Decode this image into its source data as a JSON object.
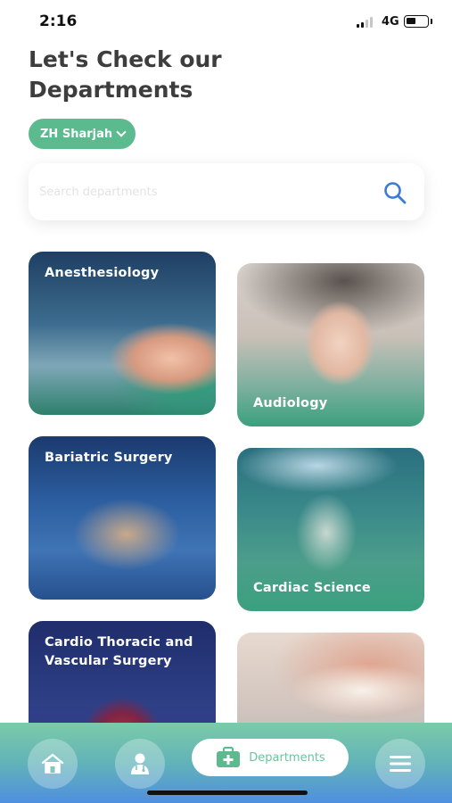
{
  "status_bar": {
    "time": "2:16",
    "network": "4G"
  },
  "header": {
    "title": "Let's Check our Departments"
  },
  "branch_selector": {
    "label": "ZH Sharjah"
  },
  "search": {
    "placeholder": "Search departments"
  },
  "departments": [
    {
      "name": "Anesthesiology"
    },
    {
      "name": "Audiology"
    },
    {
      "name": "Bariatric Surgery"
    },
    {
      "name": "Cardiac Science"
    },
    {
      "name": "Cardio Thoracic and Vascular Surgery"
    },
    {
      "name": ""
    }
  ],
  "bottom_nav": {
    "items": [
      {
        "icon": "home-icon"
      },
      {
        "icon": "doctor-icon"
      },
      {
        "icon": "first-aid-kit-icon",
        "label": "Departments"
      },
      {
        "icon": "menu-icon"
      }
    ]
  },
  "colors": {
    "accent": "#5cba8f",
    "search_icon": "#3b7bd8",
    "title": "#3d3d3d"
  }
}
